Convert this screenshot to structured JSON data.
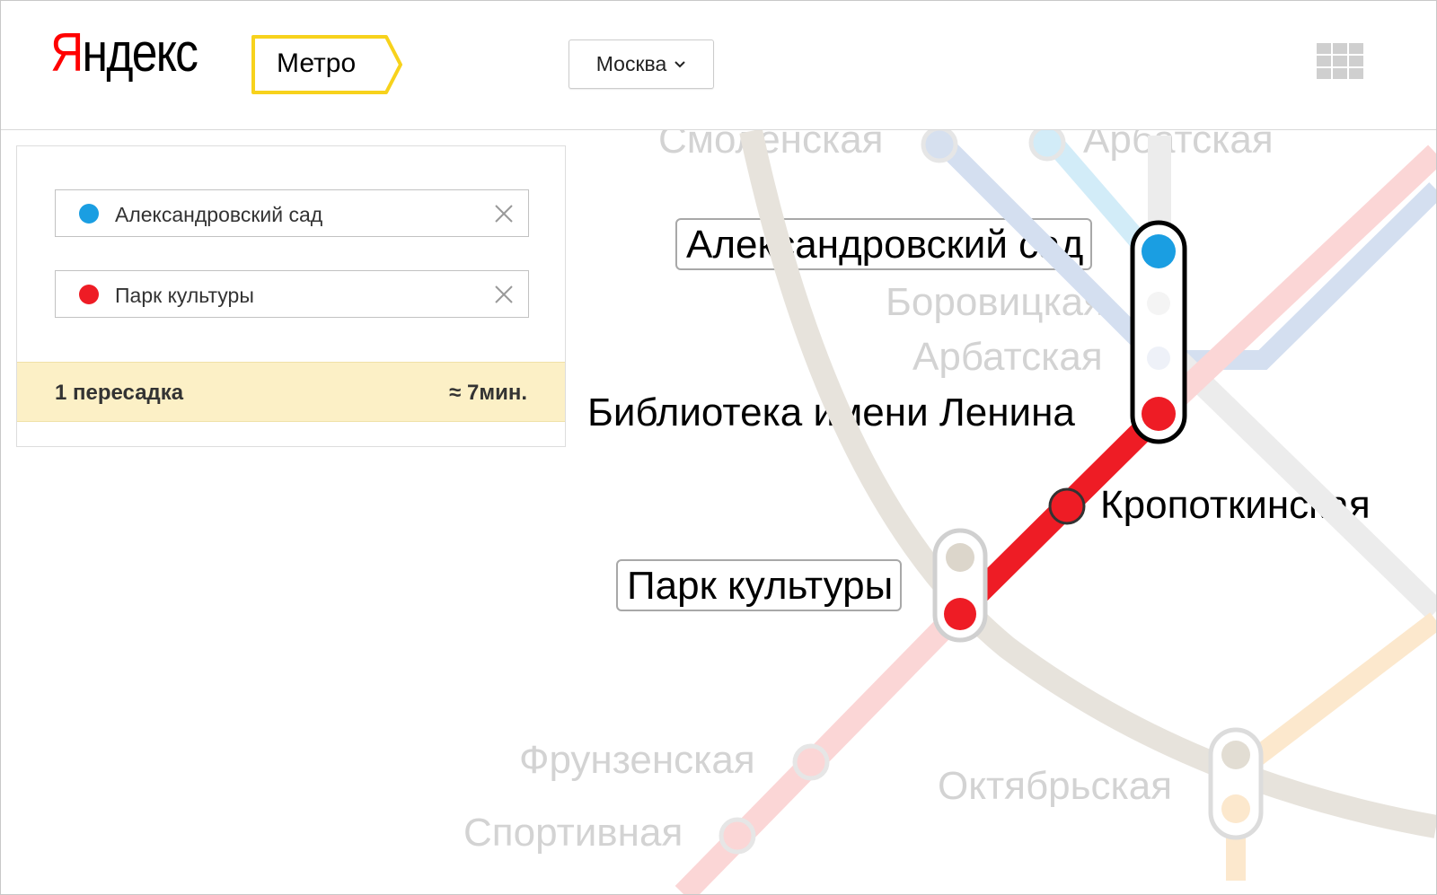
{
  "header": {
    "logo_first_letter": "Я",
    "logo_rest": "ндекс",
    "service_label": "Метро",
    "city_label": "Москва"
  },
  "route": {
    "from": {
      "station": "Александровский сад",
      "color": "#1a9ee2"
    },
    "to": {
      "station": "Парк культуры",
      "color": "#ee1c25"
    },
    "transfers_label": "1 пересадка",
    "time_label": "≈ 7мин."
  },
  "map": {
    "stations": {
      "smolenskaya": "Смоленская",
      "arbatskaya_top": "Арбатская",
      "alexandrovsky_sad": "Александровский сад",
      "borovitskaya": "Боровицкая",
      "arbatskaya": "Арбатская",
      "biblioteka_lenina": "Библиотека имени Ленина",
      "kropotkinskaya": "Кропоткинская",
      "park_kultury": "Парк культуры",
      "frunzenskaya": "Фрунзенская",
      "sportivnaya": "Спортивная",
      "oktyabrskaya": "Октябрьская"
    },
    "line_colors": {
      "sokolnicheskaya": "#ee1c25",
      "filyovskaya": "#1a9ee2",
      "arbatsko_pokrovskaya": "#0078bf",
      "serpukhovskaya": "#adacac",
      "koltsevaya": "#8d5b2d",
      "kaluzhsko_rizhskaya": "#f58631"
    }
  }
}
